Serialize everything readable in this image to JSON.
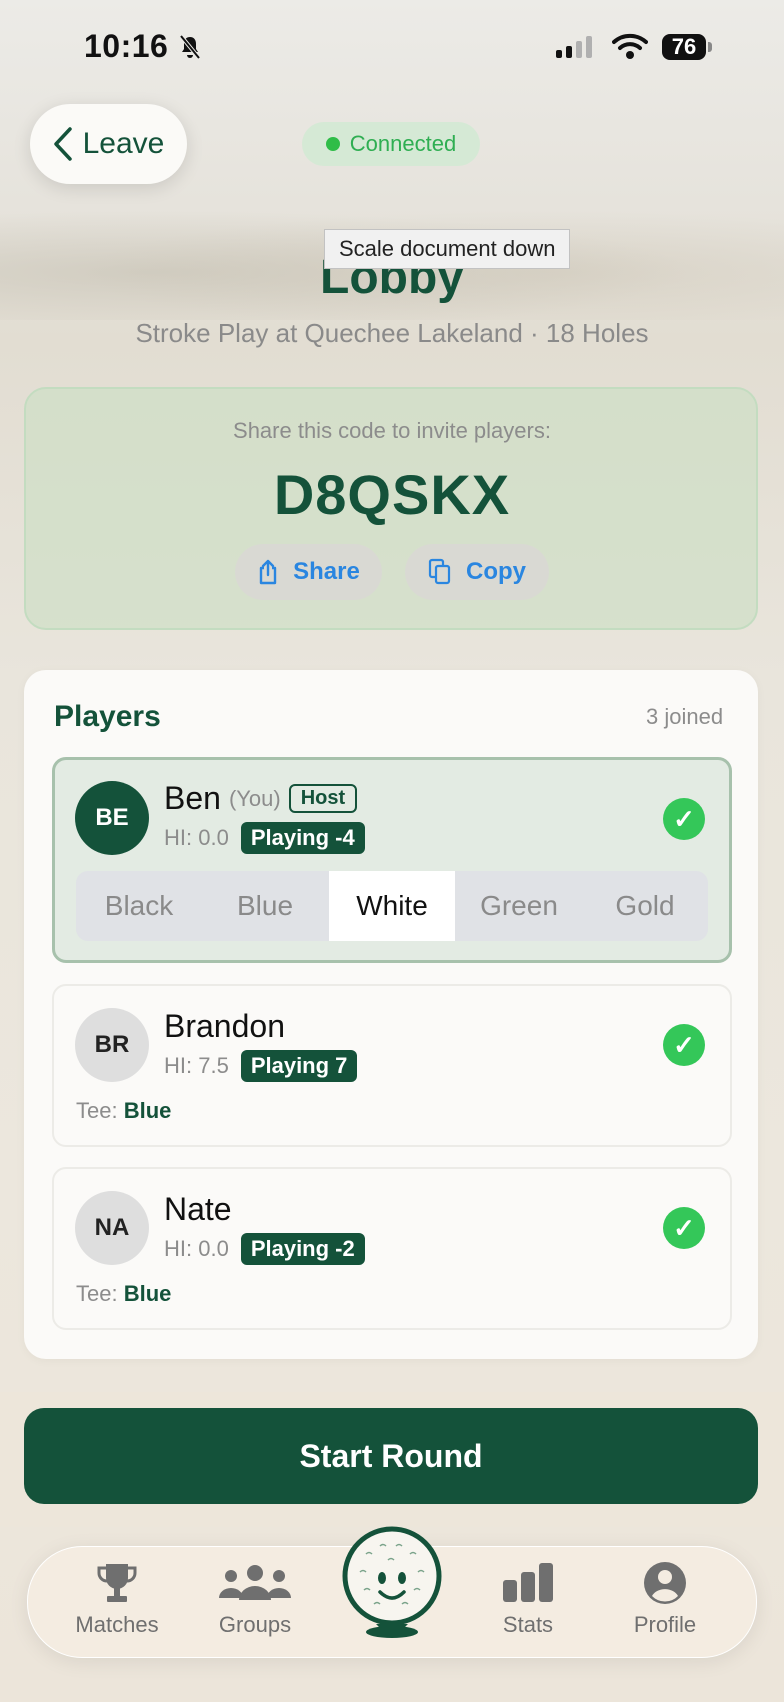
{
  "status_bar": {
    "time": "10:16",
    "battery": "76"
  },
  "header": {
    "back_label": "Leave",
    "connection_status": "Connected",
    "tooltip": "Scale document down",
    "title": "Lobby",
    "subtitle": "Stroke Play at Quechee Lakeland · 18 Holes"
  },
  "invite": {
    "label": "Share this code to invite players:",
    "code": "D8QSKX",
    "share_label": "Share",
    "copy_label": "Copy"
  },
  "players": {
    "title": "Players",
    "joined": "3 joined",
    "list": [
      {
        "initials": "BE",
        "name": "Ben",
        "you": "(You)",
        "host": "Host",
        "hi": "HI: 0.0",
        "playing": "Playing -4"
      },
      {
        "initials": "BR",
        "name": "Brandon",
        "hi": "HI: 7.5",
        "playing": "Playing 7",
        "tee_label": "Tee:",
        "tee": "Blue"
      },
      {
        "initials": "NA",
        "name": "Nate",
        "hi": "HI: 0.0",
        "playing": "Playing -2",
        "tee_label": "Tee:",
        "tee": "Blue"
      }
    ],
    "tee_options": [
      "Black",
      "Blue",
      "White",
      "Green",
      "Gold"
    ],
    "selected_tee": "White"
  },
  "actions": {
    "start_round": "Start Round"
  },
  "tabbar": {
    "items": [
      {
        "label": "Matches",
        "icon": "trophy-icon"
      },
      {
        "label": "Groups",
        "icon": "people-icon"
      },
      {
        "label": "",
        "icon": "golf-ball-mascot-icon"
      },
      {
        "label": "Stats",
        "icon": "bar-chart-icon"
      },
      {
        "label": "Profile",
        "icon": "person-circle-icon"
      }
    ]
  },
  "colors": {
    "brand": "#14523a",
    "accent_blue": "#2a86e0",
    "success": "#34c759"
  }
}
